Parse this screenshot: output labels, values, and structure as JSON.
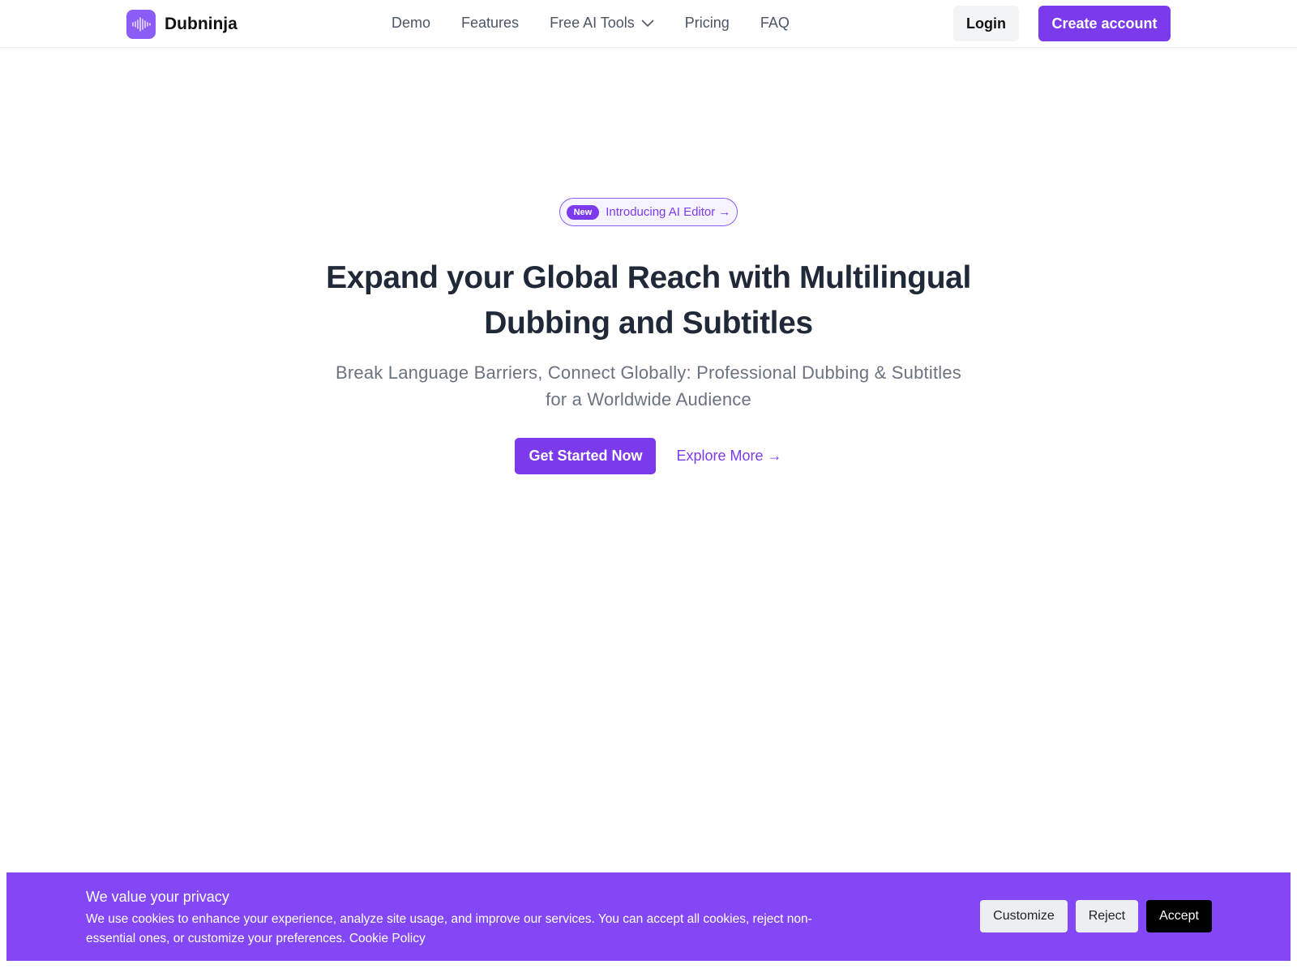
{
  "nav": {
    "brand": "Dubninja",
    "links": [
      "Demo",
      "Features",
      "Free AI Tools",
      "Pricing",
      "FAQ"
    ],
    "login": "Login",
    "create": "Create account"
  },
  "hero": {
    "badge_new": "New",
    "badge_text": "Introducing AI Editor →",
    "title_line1": "Expand your Global Reach with Multilingual",
    "title_line2": "Dubbing and Subtitles",
    "subtitle_line1": "Break Language Barriers, Connect Globally: Professional Dubbing & Subtitles",
    "subtitle_line2": "for a Worldwide Audience",
    "cta_primary": "Get Started Now",
    "cta_secondary": "Explore More →"
  },
  "cookie": {
    "title": "We value your privacy",
    "body": "We use cookies to enhance your experience, analyze site usage, and improve our services. You can accept all cookies, reject non-essential ones, or customize your preferences.",
    "policy": "Cookie Policy",
    "customize": "Customize",
    "reject": "Reject",
    "accept": "Accept"
  },
  "colors": {
    "brand": "#7c3aed",
    "cookie_bg": "#8447f6"
  }
}
